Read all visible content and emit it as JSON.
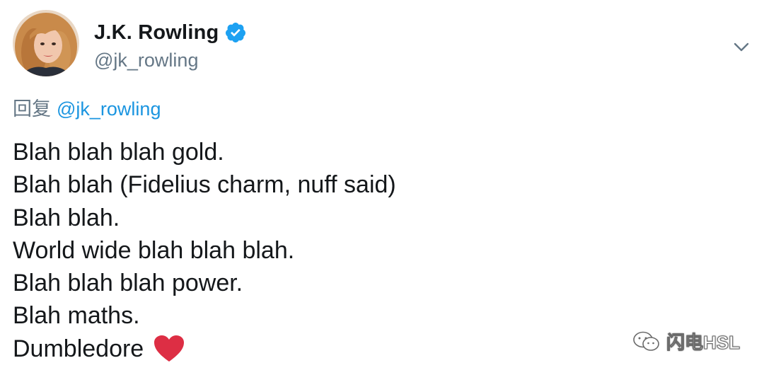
{
  "author": {
    "display_name": "J.K. Rowling",
    "handle": "@jk_rowling",
    "verified": true
  },
  "icons": {
    "verified": "verified-badge-icon",
    "caret": "chevron-down-icon",
    "heart": "red-heart-emoji",
    "watermark": "wechat-icon"
  },
  "reply": {
    "prefix": "回复",
    "mention": "@jk_rowling"
  },
  "tweet": {
    "lines": [
      "Blah blah blah gold.",
      "Blah blah (Fidelius charm, nuff said)",
      "Blah blah.",
      "World wide blah blah blah.",
      "Blah blah blah power.",
      "Blah maths.",
      "Dumbledore"
    ]
  },
  "watermark": {
    "text": "闪电HSL"
  },
  "colors": {
    "text": "#14171a",
    "secondary": "#657786",
    "link": "#1b95e0",
    "verified": "#1da1f2",
    "heart": "#dd2e44"
  }
}
